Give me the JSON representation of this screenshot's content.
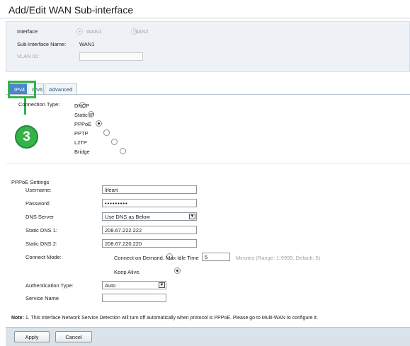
{
  "title": "Add/Edit WAN Sub-interface",
  "interface_panel": {
    "interface_label": "Interface",
    "options": [
      {
        "label": "WAN1",
        "selected": true
      },
      {
        "label": "WAN2",
        "selected": false
      }
    ],
    "sub_interface_label": "Sub-Interface Name:",
    "sub_interface_value": "WAN1",
    "vlan_label": "VLAN ID:",
    "vlan_value": ""
  },
  "tabs": [
    {
      "label": "IPv4",
      "active": true
    },
    {
      "label": "IPv6",
      "active": false
    },
    {
      "label": "Advanced",
      "active": false
    }
  ],
  "callout_number": "3",
  "connection_type": {
    "label": "Connection Type:",
    "options": [
      {
        "label": "DHCP",
        "selected": false
      },
      {
        "label": "Static IP",
        "selected": false
      },
      {
        "label": "PPPoE",
        "selected": true
      },
      {
        "label": "PPTP",
        "selected": false
      },
      {
        "label": "L2TP",
        "selected": false
      },
      {
        "label": "Bridge",
        "selected": false
      }
    ]
  },
  "pppoe": {
    "section_title": "PPPoE Settings",
    "username_label": "Username:",
    "username_value": "lifeart",
    "password_label": "Password:",
    "password_value": "•••••••••",
    "dns_server_label": "DNS Server",
    "dns_server_value": "Use DNS as Below",
    "static_dns1_label": "Static DNS 1:",
    "static_dns1_value": "208.67.222.222",
    "static_dns2_label": "Static DNS 2:",
    "static_dns2_value": "208.67.220.220",
    "connect_mode_label": "Connect Mode:",
    "connect_on_demand_label": "Connect on Demand. Max Idle Time",
    "max_idle_time_value": "5",
    "idle_hint": "Minutes (Range: 1-9999, Default: 5)",
    "keep_alive_label": "Keep Alive.",
    "connect_mode_selected": "keep_alive",
    "auth_type_label": "Authentication Type:",
    "auth_type_value": "Auto",
    "service_name_label": "Service Name",
    "service_name_value": ""
  },
  "note_bold": "Note:",
  "note_text": " 1. This interface Network Service Detection will turn off automatically when protocol is PPPoE. Please go to Multi-WAN to configure it.",
  "buttons": {
    "apply": "Apply",
    "cancel": "Cancel"
  },
  "colors": {
    "accent_green": "#35b34a",
    "tab_active": "#4a86c8"
  }
}
